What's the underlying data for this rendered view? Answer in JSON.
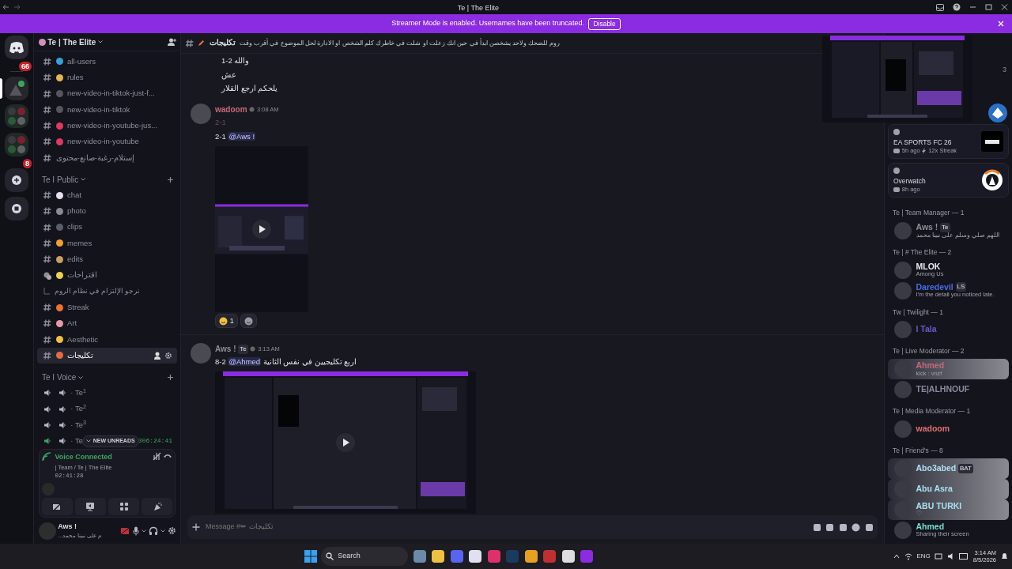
{
  "window": {
    "title": "Te | The Elite"
  },
  "banner": {
    "text": "Streamer Mode is enabled. Usernames have been truncated.",
    "button": "Disable"
  },
  "servers": [
    {
      "kind": "home",
      "badge": "66",
      "selected": false
    },
    {
      "kind": "avatar",
      "selected": true
    },
    {
      "kind": "folder",
      "selected": false
    },
    {
      "kind": "folder",
      "badge": "8",
      "selected": false
    },
    {
      "kind": "add",
      "selected": false
    },
    {
      "kind": "discover",
      "selected": false
    }
  ],
  "server": {
    "name": "Te | The Elite"
  },
  "channel_groups": [
    {
      "channels": [
        {
          "kind": "text",
          "name": "all-users",
          "color": "#3a9fd8",
          "selected": false
        },
        {
          "kind": "text",
          "name": "rules",
          "color": "#e8b64c",
          "selected": false
        },
        {
          "kind": "text",
          "name": "new-video-in-tiktok-just-f...",
          "color": "#55555e",
          "selected": false
        },
        {
          "kind": "text",
          "name": "new-video-in-tiktok",
          "color": "#55555e",
          "selected": false
        },
        {
          "kind": "text",
          "name": "new-video-in-youtube-jus...",
          "color": "#e0385f",
          "selected": false
        },
        {
          "kind": "text",
          "name": "new-video-in-youtube",
          "color": "#e0385f",
          "selected": false
        },
        {
          "kind": "plain",
          "name": "إستلام-رغبة-صانع-محتوى",
          "selected": false
        }
      ]
    },
    {
      "category": "Te I Public",
      "channels": [
        {
          "kind": "text",
          "name": "chat",
          "color": "#e6def0",
          "selected": false
        },
        {
          "kind": "text",
          "name": "photo",
          "color": "#8a8a96",
          "selected": false
        },
        {
          "kind": "text",
          "name": "clips",
          "color": "#5c5c6a",
          "selected": false
        },
        {
          "kind": "text",
          "name": "memes",
          "color": "#f0a030",
          "selected": false
        },
        {
          "kind": "text",
          "name": "edits",
          "color": "#c8a060",
          "selected": false
        },
        {
          "kind": "forum",
          "name": "اقتراحات",
          "color": "#f0d050",
          "selected": false,
          "children": [
            {
              "name": "نرجو الإلتزام في نظام الروم"
            }
          ]
        },
        {
          "kind": "text",
          "name": "Streak",
          "color": "#f07030",
          "selected": false
        },
        {
          "kind": "text",
          "name": "Art",
          "color": "#e898a8",
          "selected": false
        },
        {
          "kind": "text",
          "name": "Aesthetic",
          "color": "#f0c040",
          "selected": false
        },
        {
          "kind": "text",
          "name": "تكليجات",
          "color": "#e86a40",
          "selected": true
        }
      ]
    },
    {
      "category": "Te I Voice",
      "channels": [
        {
          "kind": "voice",
          "name": "· Te$^{1}$",
          "connected": false,
          "selected": false
        },
        {
          "kind": "voice",
          "name": "· Te$^{2}$",
          "connected": false,
          "selected": false
        },
        {
          "kind": "voice",
          "name": "· Te$^{3}$",
          "connected": false,
          "selected": false
        },
        {
          "kind": "voice",
          "name": "· Te",
          "connected": true,
          "timer": "306:24:41",
          "selected": false
        }
      ]
    }
  ],
  "new_unreads": "NEW UNREADS",
  "voice_panel": {
    "status": "Voice Connected",
    "channel": "| Team / Te | The Elite",
    "time": "02:41:28"
  },
  "user": {
    "name": "Aws !",
    "status": "...م على نبينا محمد"
  },
  "header": {
    "channel": "تكليجات",
    "topic": "روم للضحك ولاحد يشخصن ابدأ في حين انك زعلت او شلت في خاطرك كلم الشخص او الادارة لحل الموضوع في أقرب وقت"
  },
  "messages": [
    {
      "kind": "continuation",
      "lines": [
        [
          {
            "kind": "text",
            "text": "والله 2-1"
          }
        ],
        [
          {
            "kind": "text",
            "text": "عش"
          }
        ],
        [
          {
            "kind": "text",
            "text": "يلحكم ارجع القلار"
          }
        ]
      ]
    },
    {
      "kind": "message",
      "author": "wadoom",
      "color": "#c46a7a",
      "time": "3:08 AM",
      "lines": [
        [
          {
            "kind": "faded",
            "text": "2-1"
          }
        ],
        [
          {
            "kind": "text",
            "text": "2-1 "
          },
          {
            "kind": "mention",
            "text": "@Aws !"
          }
        ]
      ],
      "attachment": {
        "kind": "portrait"
      },
      "reactions": [
        {
          "count": "1",
          "kind": "laugh"
        },
        {
          "kind": "add"
        }
      ]
    },
    {
      "kind": "message",
      "author": "Aws !",
      "color": "#8e8e96",
      "tag": "Te",
      "time": "3:13 AM",
      "lines": [
        [
          {
            "kind": "text",
            "text": "8-2 "
          },
          {
            "kind": "mention",
            "text": "@Ahmed"
          },
          {
            "kind": "text",
            "text": " اربع تكليجيين في نفس الثانية"
          }
        ]
      ],
      "attachment": {
        "kind": "landscape"
      }
    }
  ],
  "composer": {
    "placeholder": "Message #✏ تكليجات"
  },
  "preview_count": "3",
  "activities": [
    {
      "kind": "fc",
      "name": "EA SPORTS FC 26",
      "time": "5h ago",
      "extra": "12x Streak"
    },
    {
      "kind": "ow",
      "name": "Overwatch",
      "time": "8h ago"
    }
  ],
  "member_groups": [
    {
      "title": "Te | Team Manager — 1",
      "members": [
        {
          "name": "Aws !",
          "color": "#8e8e96",
          "tag": "Te",
          "status": "اللهم صلي وسلم على نبينا محمد"
        }
      ]
    },
    {
      "title": "Te | # The Elite — 2",
      "members": [
        {
          "name": "MLOK",
          "color": "#e8e8f0",
          "status": "Among Us"
        },
        {
          "name": "Daredevil",
          "color": "#4a6ae0",
          "tag": "LS",
          "status": "I'm the detail you noticed late."
        }
      ]
    },
    {
      "title": "Tw | Twilight — 1",
      "members": [
        {
          "name": "I Tala",
          "color": "#6a5ac8"
        }
      ]
    },
    {
      "title": "Te | Live Moderator — 2",
      "members": [
        {
          "name": "Ahmed",
          "color": "#c46a7a",
          "status": "kick : vnzf",
          "banner": true
        },
        {
          "name": "TE|ALHNOUF",
          "color": "#8a8aa0"
        }
      ]
    },
    {
      "title": "Te | Media Moderator — 1",
      "members": [
        {
          "name": "wadoom",
          "color": "#e07070"
        }
      ]
    },
    {
      "title": "Te | Friend's — 8",
      "members": [
        {
          "name": "Abo3abed",
          "color": "#a8e0f0",
          "tag": "BAT",
          "banner": true
        },
        {
          "name": "Abu Asra",
          "color": "#a8e0f0",
          "banner": true
        },
        {
          "name": "ABU TURKI",
          "color": "#a8e0f0",
          "status": "♡",
          "banner": true
        },
        {
          "name": "Ahmed",
          "color": "#70e0d0",
          "status": "Sharing their screen"
        }
      ]
    }
  ],
  "taskbar": {
    "search": "Search",
    "language": "ENG",
    "time": "3:14 AM",
    "date": "8/5/2026"
  }
}
